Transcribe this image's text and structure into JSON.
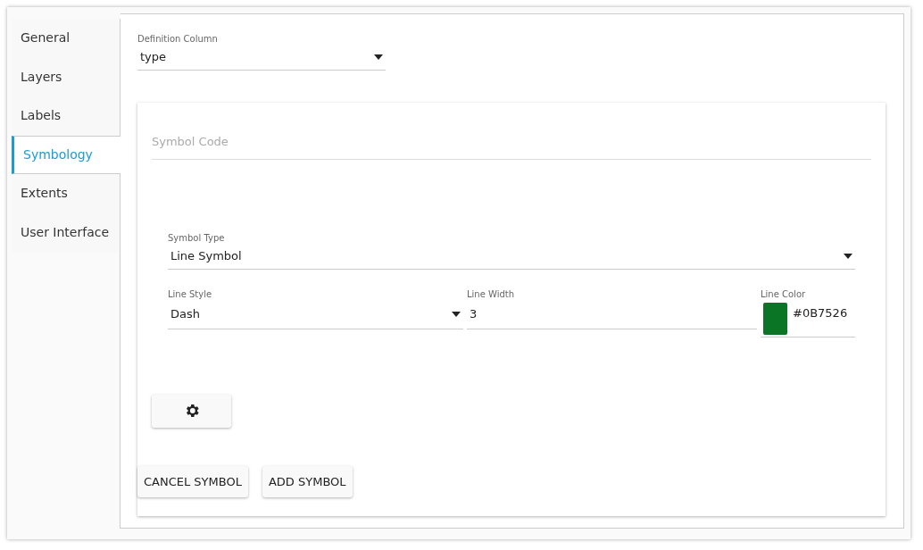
{
  "tabs": [
    {
      "label": "General",
      "selected": false
    },
    {
      "label": "Layers",
      "selected": false
    },
    {
      "label": "Labels",
      "selected": false
    },
    {
      "label": "Symbology",
      "selected": true
    },
    {
      "label": "Extents",
      "selected": false
    },
    {
      "label": "User Interface",
      "selected": false
    }
  ],
  "definition_column": {
    "label": "Definition Column",
    "value": "type"
  },
  "symbol_code": {
    "placeholder": "Symbol Code"
  },
  "symbol_type": {
    "label": "Symbol Type",
    "value": "Line Symbol"
  },
  "line_style": {
    "label": "Line Style",
    "value": "Dash"
  },
  "line_width": {
    "label": "Line Width",
    "value": "3"
  },
  "line_color": {
    "label": "Line Color",
    "value": "#0B7526"
  },
  "buttons": [
    "CANCEL SYMBOL",
    "ADD SYMBOL"
  ]
}
